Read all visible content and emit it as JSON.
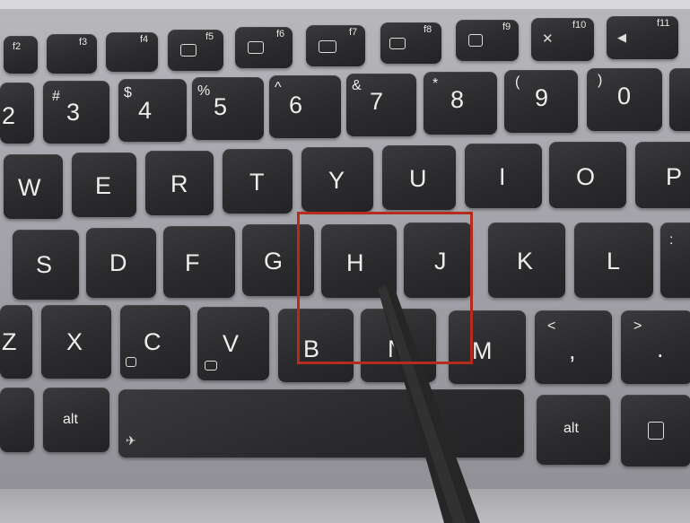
{
  "keyboard": {
    "function_row": [
      {
        "key": "f2-key",
        "label": "f2"
      },
      {
        "key": "f3-key",
        "label": "f3"
      },
      {
        "key": "f4-key",
        "label": "f4"
      },
      {
        "key": "f5-key",
        "label": "f5"
      },
      {
        "key": "f6-key",
        "label": "f6"
      },
      {
        "key": "f7-key",
        "label": "f7"
      },
      {
        "key": "f8-key",
        "label": "f8"
      },
      {
        "key": "f9-key",
        "label": "f9"
      },
      {
        "key": "f10-key",
        "label": "f10"
      },
      {
        "key": "f11-key",
        "label": "f11"
      }
    ],
    "number_row": [
      {
        "main": "2",
        "shift": ""
      },
      {
        "main": "3",
        "shift": "#"
      },
      {
        "main": "4",
        "shift": "$"
      },
      {
        "main": "5",
        "shift": "%"
      },
      {
        "main": "6",
        "shift": "^"
      },
      {
        "main": "7",
        "shift": "&"
      },
      {
        "main": "8",
        "shift": "*"
      },
      {
        "main": "9",
        "shift": "("
      },
      {
        "main": "0",
        "shift": ")"
      }
    ],
    "top_row": [
      "W",
      "E",
      "R",
      "T",
      "Y",
      "U",
      "I",
      "O",
      "P"
    ],
    "home_row": [
      "S",
      "D",
      "F",
      "G",
      "H",
      "J",
      "K",
      "L"
    ],
    "bottom_row": [
      "Z",
      "X",
      "C",
      "V",
      "B",
      "N",
      "M"
    ],
    "comma_key": {
      "main": ",",
      "shift": "<"
    },
    "period_key": {
      "main": ".",
      "shift": ">"
    },
    "semicolon_key": {
      "shift": ":"
    },
    "left_alt": "alt",
    "right_alt": "alt"
  }
}
